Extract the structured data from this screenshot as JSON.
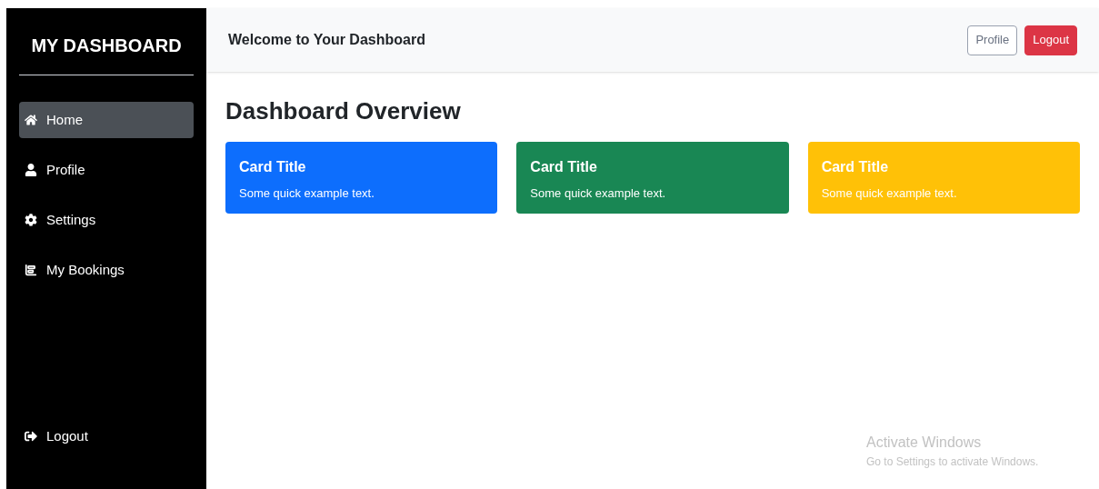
{
  "sidebar": {
    "title": "MY DASHBOARD",
    "items": [
      {
        "label": "Home",
        "selected": true
      },
      {
        "label": "Profile",
        "selected": false
      },
      {
        "label": "Settings",
        "selected": false
      },
      {
        "label": "My Bookings",
        "selected": false
      }
    ],
    "logout": "Logout"
  },
  "header": {
    "title": "Welcome to Your Dashboard",
    "buttons": [
      {
        "label": "Profile",
        "kind": "outline"
      },
      {
        "label": "Logout",
        "kind": "danger"
      }
    ]
  },
  "main": {
    "heading": "Dashboard Overview",
    "cards": [
      {
        "title": "Card Title",
        "text": "Some quick example text.",
        "color": "#0d6efd"
      },
      {
        "title": "Card Title",
        "text": "Some quick example text.",
        "color": "#198754"
      },
      {
        "title": "Card Title",
        "text": "Some quick example text.",
        "color": "#ffc107"
      }
    ]
  },
  "activation": {
    "title": "Activate Windows",
    "text": "Go to Settings to activate Windows."
  }
}
